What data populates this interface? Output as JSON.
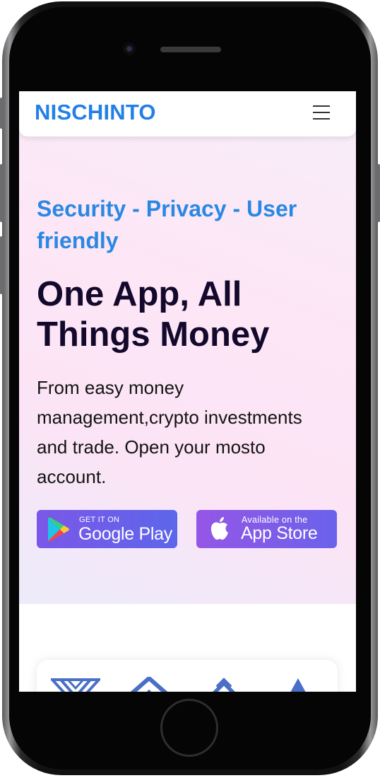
{
  "brand": {
    "name": "NISCHINTO",
    "color": "#2380e6"
  },
  "nav": {
    "menu_icon": "hamburger-menu-icon"
  },
  "hero": {
    "tagline": "Security - Privacy - User friendly",
    "headline": "One App, All Things Money",
    "description": "From easy money management,crypto investments and trade. Open your mosto account."
  },
  "store_buttons": {
    "google_play": {
      "small": "GET IT ON",
      "big": "Google Play",
      "icon": "google-play-icon"
    },
    "app_store": {
      "small": "Available on the",
      "big": "App Store",
      "icon": "apple-icon"
    }
  },
  "partners": {
    "icons": [
      "partner-logo-1-icon",
      "partner-logo-2-icon",
      "partner-logo-3-icon",
      "partner-logo-4-icon"
    ]
  },
  "colors": {
    "accent": "#2a88e3",
    "headline": "#13092c",
    "button_gradient": "#7b57e8"
  }
}
